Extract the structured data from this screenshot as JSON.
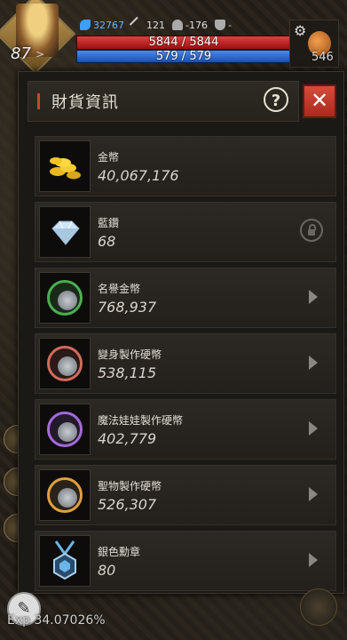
{
  "hud": {
    "level": "87",
    "gems": "32767",
    "attack": "121",
    "defense": "-176",
    "trophy": "-",
    "hp": "5844 / 5844",
    "mp": "579 / 579",
    "potion_count": "546",
    "exp": "Exp 34.07026%"
  },
  "panel": {
    "title": "財貨資訊",
    "help_label": "?",
    "close_label": "✕"
  },
  "items": [
    {
      "name": "金幣",
      "amount": "40,067,176",
      "icon": "gold-coins-icon",
      "action": "none"
    },
    {
      "name": "藍鑽",
      "amount": "68",
      "icon": "blue-diamond-icon",
      "action": "lock"
    },
    {
      "name": "名譽金幣",
      "amount": "768,937",
      "icon": "honor-coin-icon",
      "action": "arrow",
      "ring": "#4caf50"
    },
    {
      "name": "變身製作硬幣",
      "amount": "538,115",
      "icon": "transform-coin-icon",
      "action": "arrow",
      "ring": "#d36a5a"
    },
    {
      "name": "魔法娃娃製作硬幣",
      "amount": "402,779",
      "icon": "magic-doll-coin-icon",
      "action": "arrow",
      "ring": "#a46ad8"
    },
    {
      "name": "聖物製作硬幣",
      "amount": "526,307",
      "icon": "relic-coin-icon",
      "action": "arrow",
      "ring": "#e0a040"
    },
    {
      "name": "銀色勳章",
      "amount": "80",
      "icon": "silver-medal-icon",
      "action": "arrow"
    }
  ]
}
